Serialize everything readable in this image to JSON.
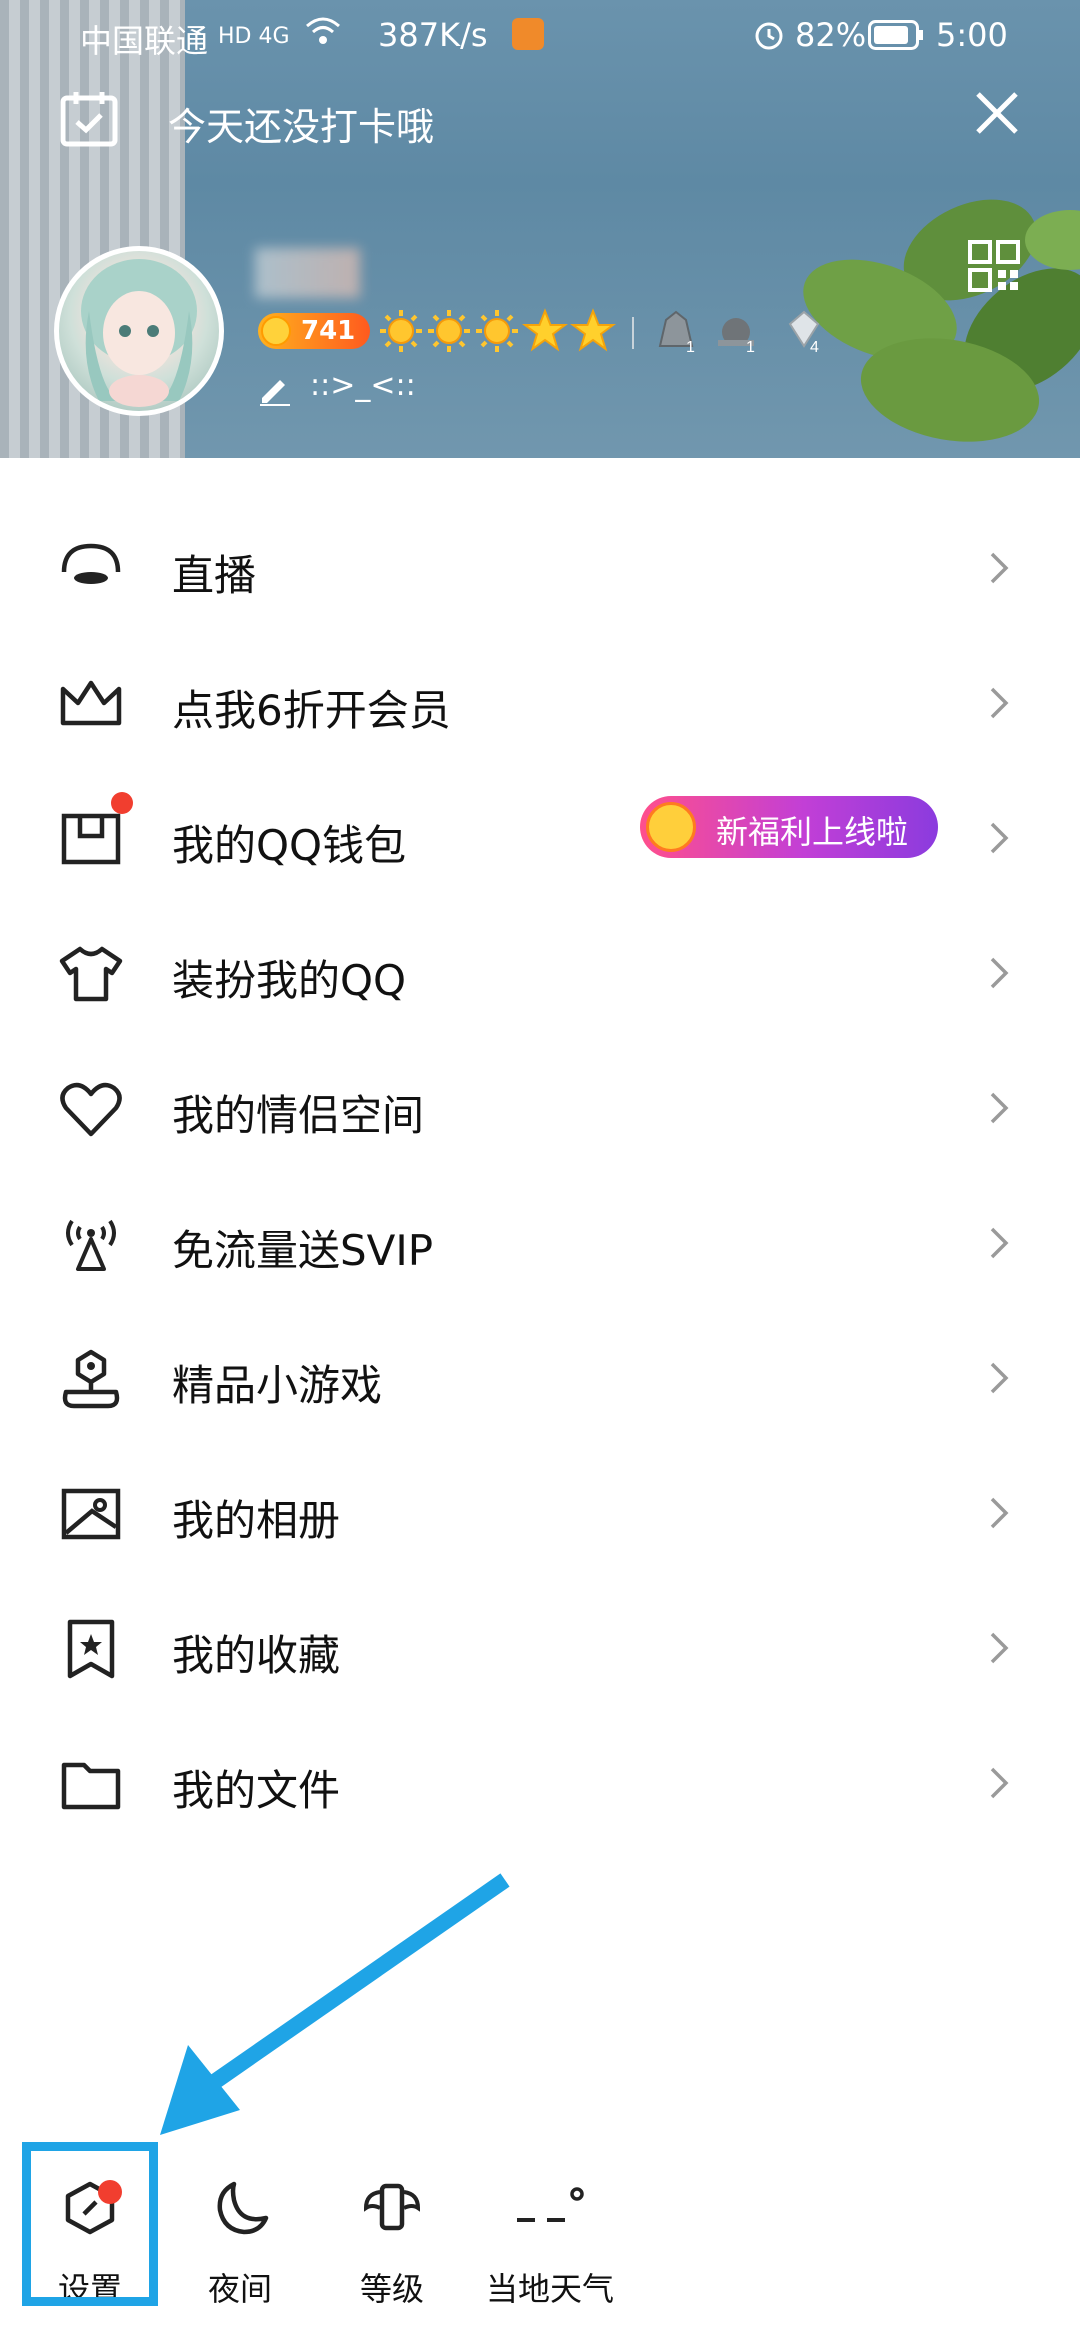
{
  "status_bar": {
    "carrier": "中国联通",
    "network": "HD 4G",
    "speed": "387K/s",
    "battery": "82%",
    "time": "5:00"
  },
  "header": {
    "checkin_text": "今天还没打卡哦",
    "level_number": "741",
    "signature": "::>_<::",
    "medals": [
      {
        "count": "1"
      },
      {
        "count": "1"
      },
      {
        "count": "4"
      }
    ]
  },
  "menu": {
    "items": [
      {
        "label": "直播",
        "icon": "live-icon"
      },
      {
        "label": "点我6折开会员",
        "icon": "crown-icon"
      },
      {
        "label": "我的QQ钱包",
        "icon": "wallet-icon",
        "badge_dot": true,
        "promo": "新福利上线啦"
      },
      {
        "label": "装扮我的QQ",
        "icon": "tshirt-icon"
      },
      {
        "label": "我的情侣空间",
        "icon": "heart-icon"
      },
      {
        "label": "免流量送SVIP",
        "icon": "antenna-icon"
      },
      {
        "label": "精品小游戏",
        "icon": "game-icon"
      },
      {
        "label": "我的相册",
        "icon": "album-icon"
      },
      {
        "label": "我的收藏",
        "icon": "bookmark-icon"
      },
      {
        "label": "我的文件",
        "icon": "folder-icon"
      }
    ]
  },
  "bottom_bar": {
    "settings": "设置",
    "night": "夜间",
    "level": "等级",
    "weather": "当地天气"
  },
  "colors": {
    "annotation_blue": "#1fa4e6",
    "badge_red": "#f13e2f",
    "promo_gradient_start": "#ff4f8c",
    "promo_gradient_end": "#8b3bde"
  }
}
